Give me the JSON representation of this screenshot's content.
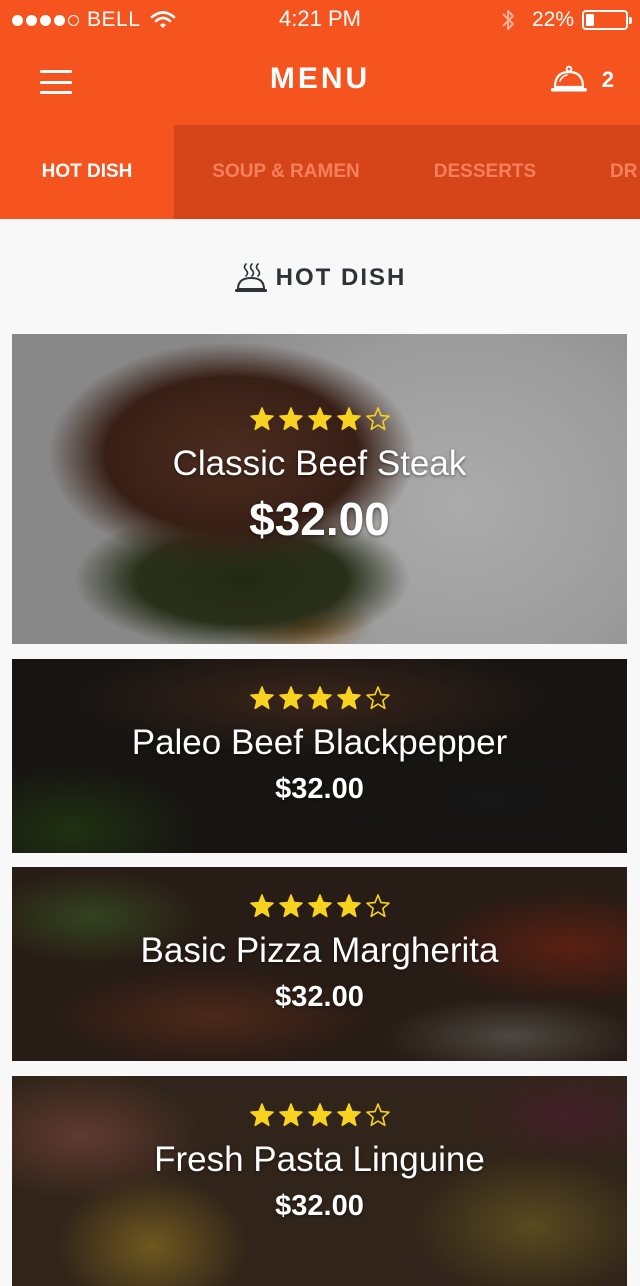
{
  "status_bar": {
    "carrier": "BELL",
    "signal_bars_filled": 4,
    "signal_bars_total": 5,
    "time": "4:21 PM",
    "battery_pct": "22%",
    "battery_level": 0.22,
    "icons": [
      "wifi-icon",
      "bluetooth-icon",
      "battery-icon"
    ]
  },
  "nav": {
    "title": "MENU",
    "cart_count": "2",
    "icons": [
      "hamburger-menu-icon",
      "cloche-icon"
    ]
  },
  "tabs": [
    {
      "label": "HOT DISH",
      "active": true
    },
    {
      "label": "SOUP & RAMEN",
      "active": false
    },
    {
      "label": "DESSERTS",
      "active": false
    },
    {
      "label": "DR",
      "active": false
    }
  ],
  "section": {
    "title": "HOT DISH",
    "icon": "steaming-cloche-icon"
  },
  "items": [
    {
      "name": "Classic Beef Steak",
      "price": "$32.00",
      "rating": 4,
      "max_rating": 5
    },
    {
      "name": "Paleo Beef Blackpepper",
      "price": "$32.00",
      "rating": 4,
      "max_rating": 5
    },
    {
      "name": "Basic Pizza Margherita",
      "price": "$32.00",
      "rating": 4,
      "max_rating": 5
    },
    {
      "name": "Fresh Pasta Linguine",
      "price": "$32.00",
      "rating": 4,
      "max_rating": 5
    }
  ],
  "colors": {
    "brand": "#f5541f",
    "tab_bar": "#d6441a",
    "tab_inactive_text": "#f5815c",
    "star": "#f7d21e",
    "background": "#f8f8f8"
  }
}
